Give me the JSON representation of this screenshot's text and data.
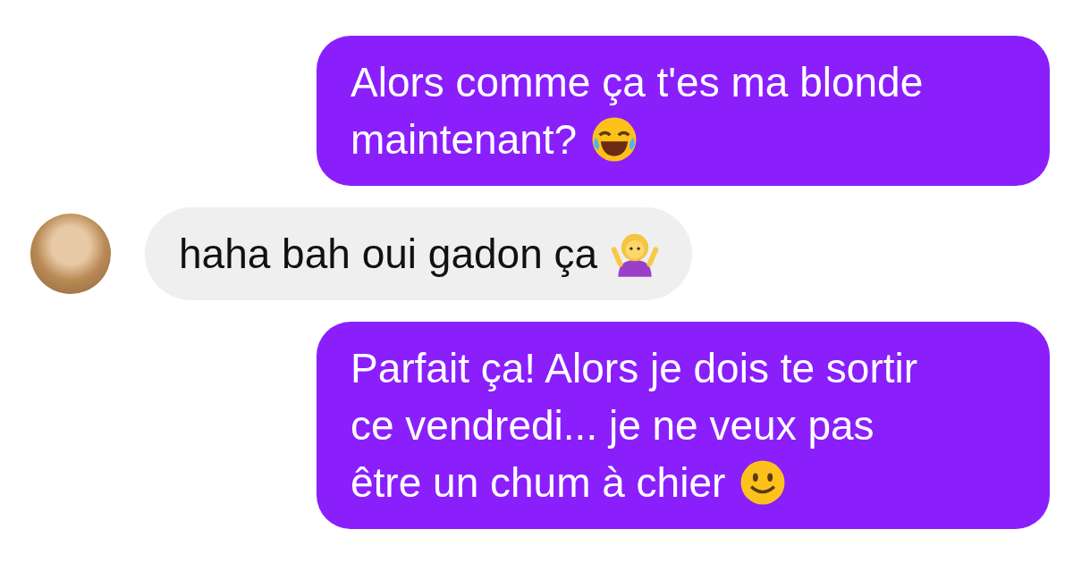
{
  "messages": [
    {
      "kind": "sent",
      "lines": [
        "Alors comme ça t'es ma blonde",
        "maintenant?"
      ],
      "emoji": {
        "kind": "laughing"
      }
    },
    {
      "kind": "received",
      "lines": [
        "haha bah oui gadon ça"
      ],
      "emoji": {
        "kind": "shrug"
      }
    },
    {
      "kind": "sent",
      "lines": [
        "Parfait ça! Alors je dois te sortir",
        "ce vendredi... je ne veux pas",
        "être un chum à chier"
      ],
      "emoji": {
        "kind": "smile"
      }
    }
  ]
}
